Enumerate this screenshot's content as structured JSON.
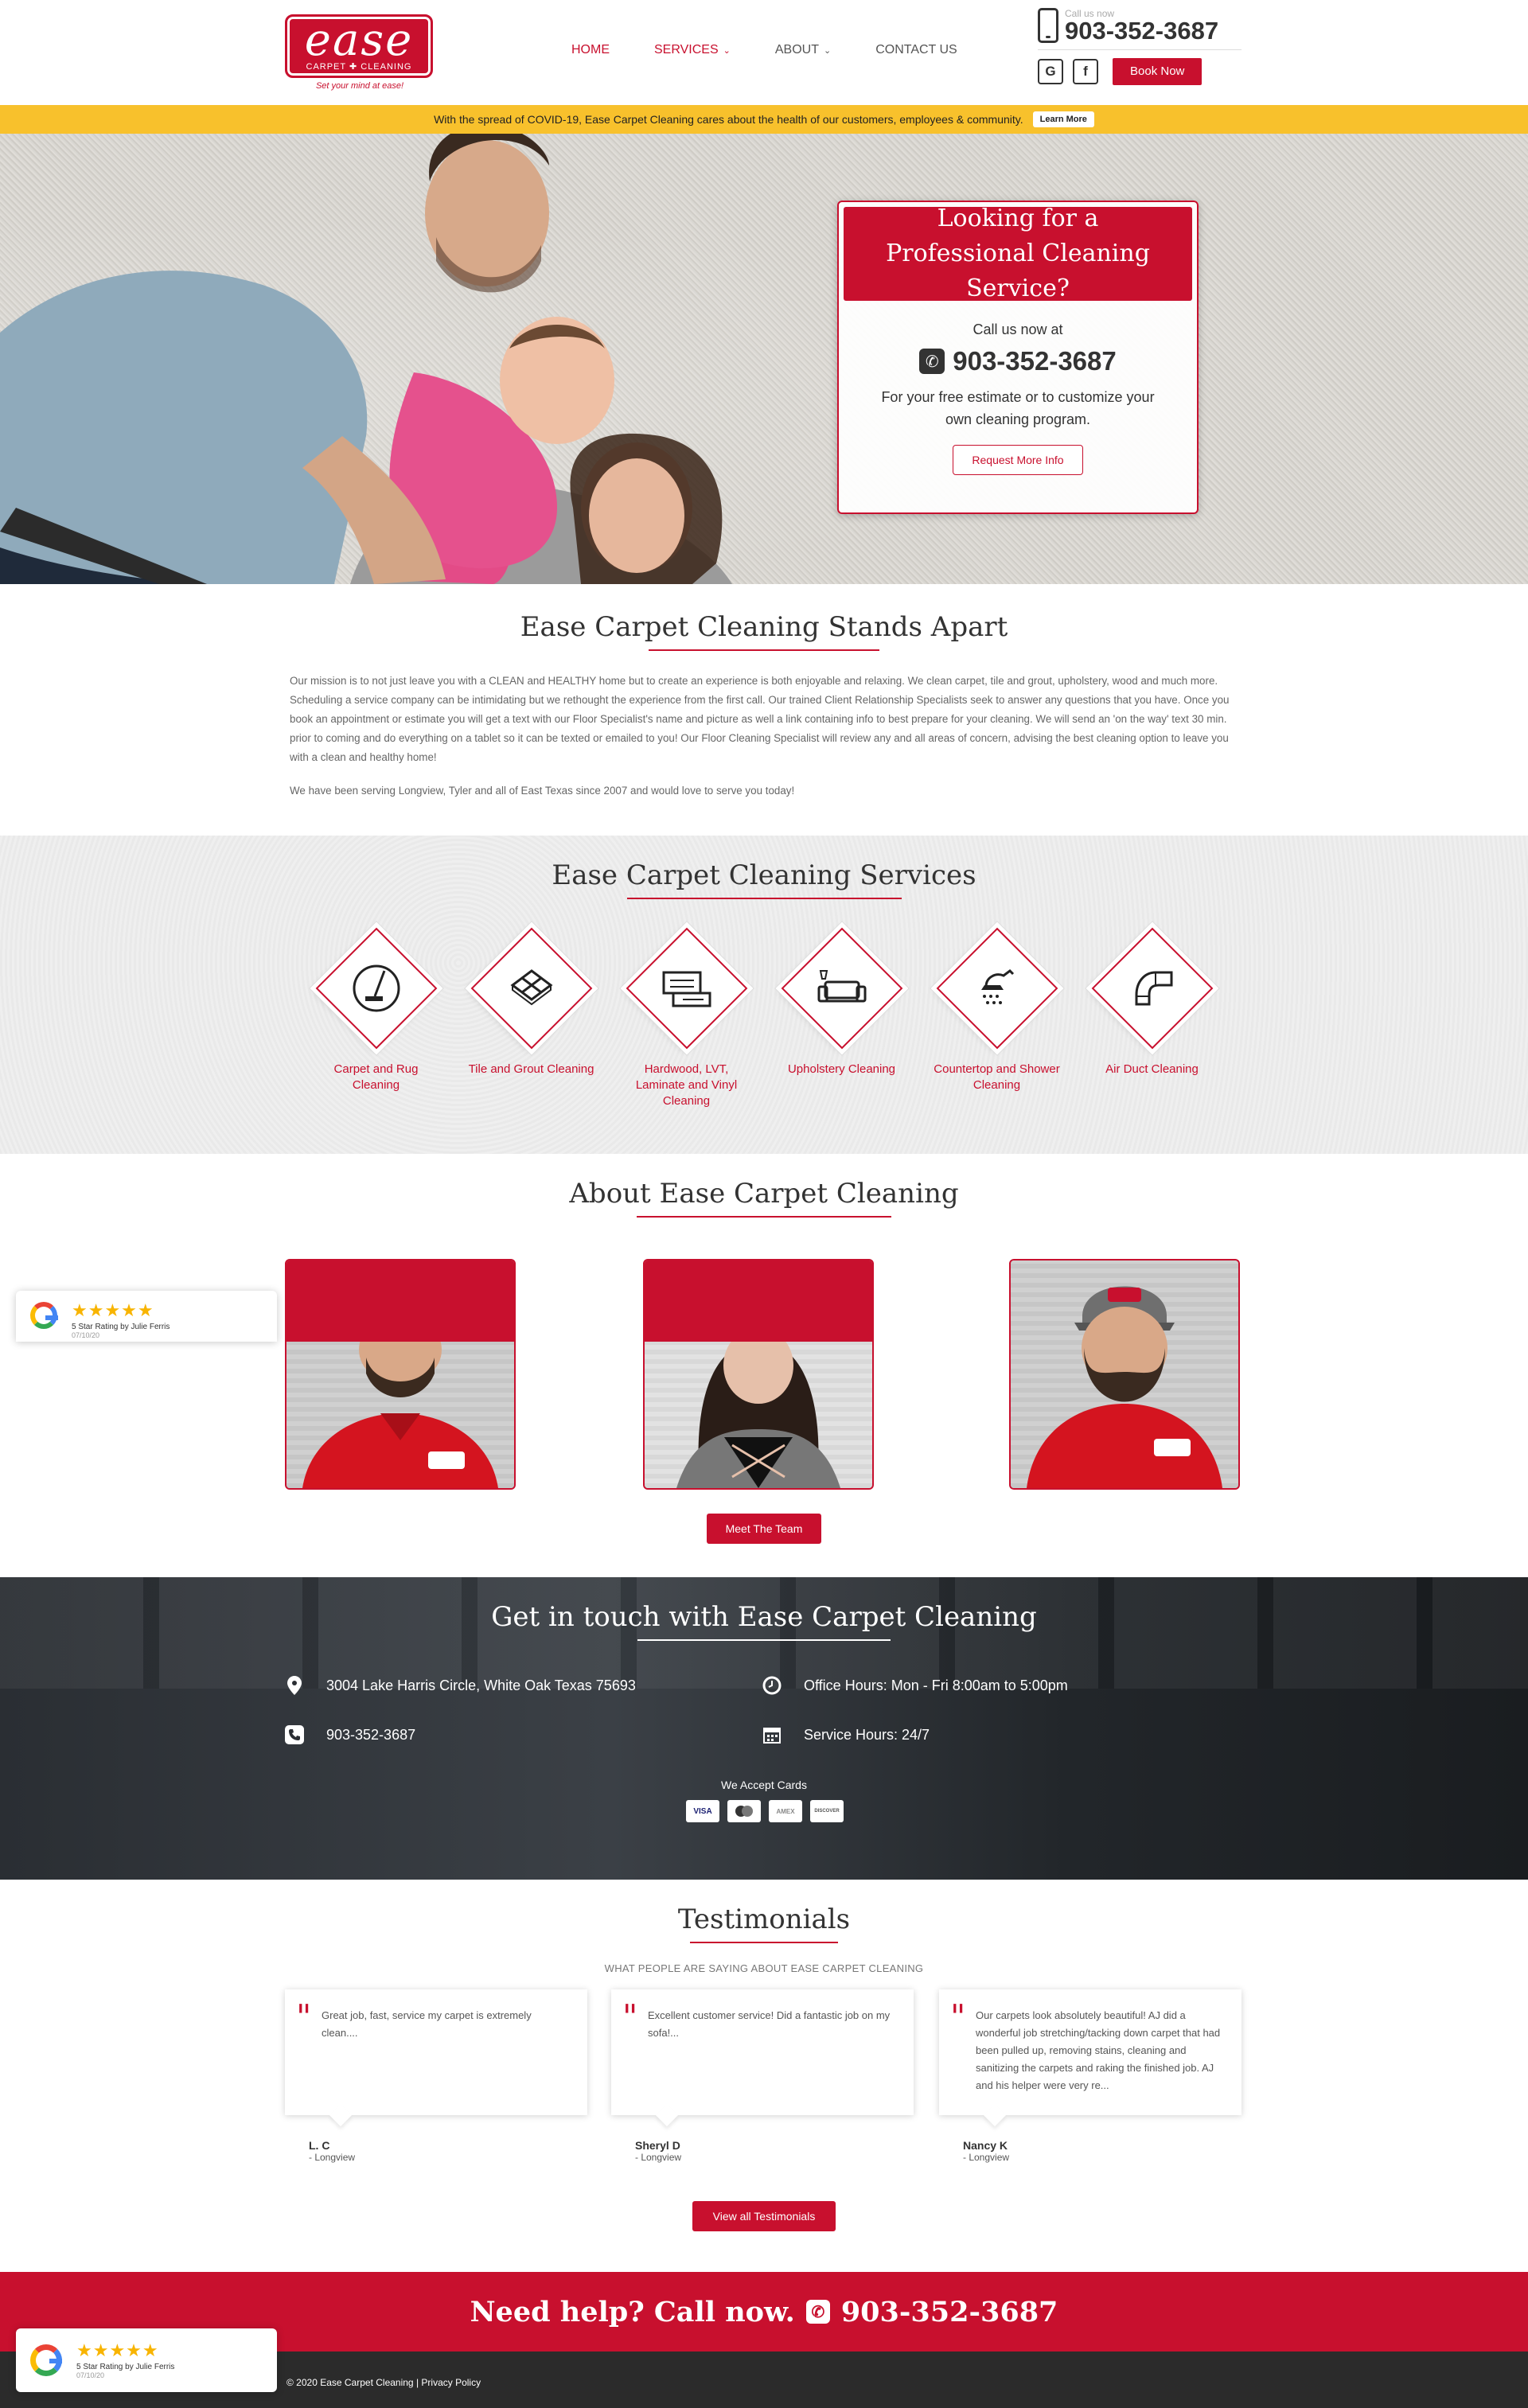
{
  "header": {
    "logo_word": "ease",
    "logo_sub": "CARPET ✚ CLEANING",
    "logo_tag": "Set your mind at ease!",
    "nav": [
      {
        "label": "HOME",
        "dropdown": false
      },
      {
        "label": "SERVICES",
        "dropdown": true
      },
      {
        "label": "ABOUT",
        "dropdown": true
      },
      {
        "label": "CONTACT US",
        "dropdown": false
      }
    ],
    "call_label": "Call us now",
    "phone": "903-352-3687",
    "google_letter": "G",
    "facebook_letter": "f",
    "book_label": "Book Now"
  },
  "covid": {
    "text": "With the spread of COVID-19, Ease Carpet Cleaning cares about the health of our customers, employees & community.",
    "button": "Learn More"
  },
  "hero": {
    "title": "Looking for a Professional Cleaning Service?",
    "call_at": "Call us now at",
    "phone": "903-352-3687",
    "desc": "For your free estimate or to customize your own cleaning program.",
    "button": "Request More Info"
  },
  "stands": {
    "title": "Ease Carpet Cleaning Stands Apart",
    "p1": "Our mission is to not just leave you with a CLEAN and HEALTHY home but to create an experience is both enjoyable and relaxing. We clean carpet, tile and grout, upholstery, wood and much more. Scheduling a service company can be intimidating but we rethought the experience from the first call. Our trained Client Relationship Specialists seek to answer any questions that you have. Once you book an appointment or estimate you will get a text with our Floor Specialist's name and picture as well a link containing info to best prepare for your cleaning. We will send an 'on the way' text 30 min. prior to coming and do everything on a tablet so it can be texted or emailed to you! Our Floor Cleaning Specialist will review any and all areas of concern, advising the best cleaning option to leave you with a clean and healthy home!",
    "p2": "We have been serving Longview, Tyler and all of East Texas since 2007 and would love to serve you today!"
  },
  "services": {
    "title": "Ease Carpet Cleaning Services",
    "items": [
      {
        "label": "Carpet and Rug Cleaning",
        "icon": "carpet-cleaner-icon"
      },
      {
        "label": "Tile and Grout Cleaning",
        "icon": "tile-icon"
      },
      {
        "label": "Hardwood, LVT, Laminate and Vinyl Cleaning",
        "icon": "hardwood-icon"
      },
      {
        "label": "Upholstery Cleaning",
        "icon": "sofa-icon"
      },
      {
        "label": "Countertop and Shower Cleaning",
        "icon": "shower-icon"
      },
      {
        "label": "Air Duct Cleaning",
        "icon": "air-duct-icon"
      }
    ]
  },
  "about": {
    "title": "About Ease Carpet Cleaning",
    "button": "Meet The Team"
  },
  "contact": {
    "title": "Get in touch with Ease Carpet Cleaning",
    "address": "3004 Lake Harris Circle, White Oak Texas 75693",
    "phone": "903-352-3687",
    "office_hours": "Office Hours: Mon - Fri 8:00am to 5:00pm",
    "service_hours": "Service Hours: 24/7",
    "cards_label": "We Accept Cards",
    "cards": [
      "VISA",
      "MC",
      "AMEX",
      "DISCOVER"
    ]
  },
  "testimonials": {
    "title": "Testimonials",
    "subtitle": "WHAT PEOPLE ARE SAYING ABOUT EASE CARPET CLEANING",
    "items": [
      {
        "text": "Great job, fast, service my carpet is extremely clean....",
        "name": "L. C",
        "loc": "- Longview"
      },
      {
        "text": "Excellent customer service! Did a fantastic job on my sofa!...",
        "name": "Sheryl D",
        "loc": "- Longview"
      },
      {
        "text": "Our carpets look absolutely beautiful! AJ did a wonderful job stretching/tacking down carpet that had been pulled up, removing stains, cleaning and sanitizing the carpets and raking the finished job. AJ and his helper were very re...",
        "name": "Nancy K",
        "loc": "- Longview"
      }
    ],
    "button": "View all Testimonials"
  },
  "needhelp": {
    "text": "Need help? Call now.",
    "phone": "903-352-3687"
  },
  "footer": {
    "copyright": "© 2020 Ease Carpet Cleaning",
    "sep": " | ",
    "privacy": "Privacy Policy"
  },
  "google_badge": {
    "stars": "★★★★★",
    "rating_prefix": "5 Star Rating",
    "by": " by Julie Ferris",
    "date": "07/10/20"
  },
  "colors": {
    "brand_red": "#c8102e",
    "covid_yellow": "#f8c12c",
    "footer_dark": "#2b2b2b"
  }
}
